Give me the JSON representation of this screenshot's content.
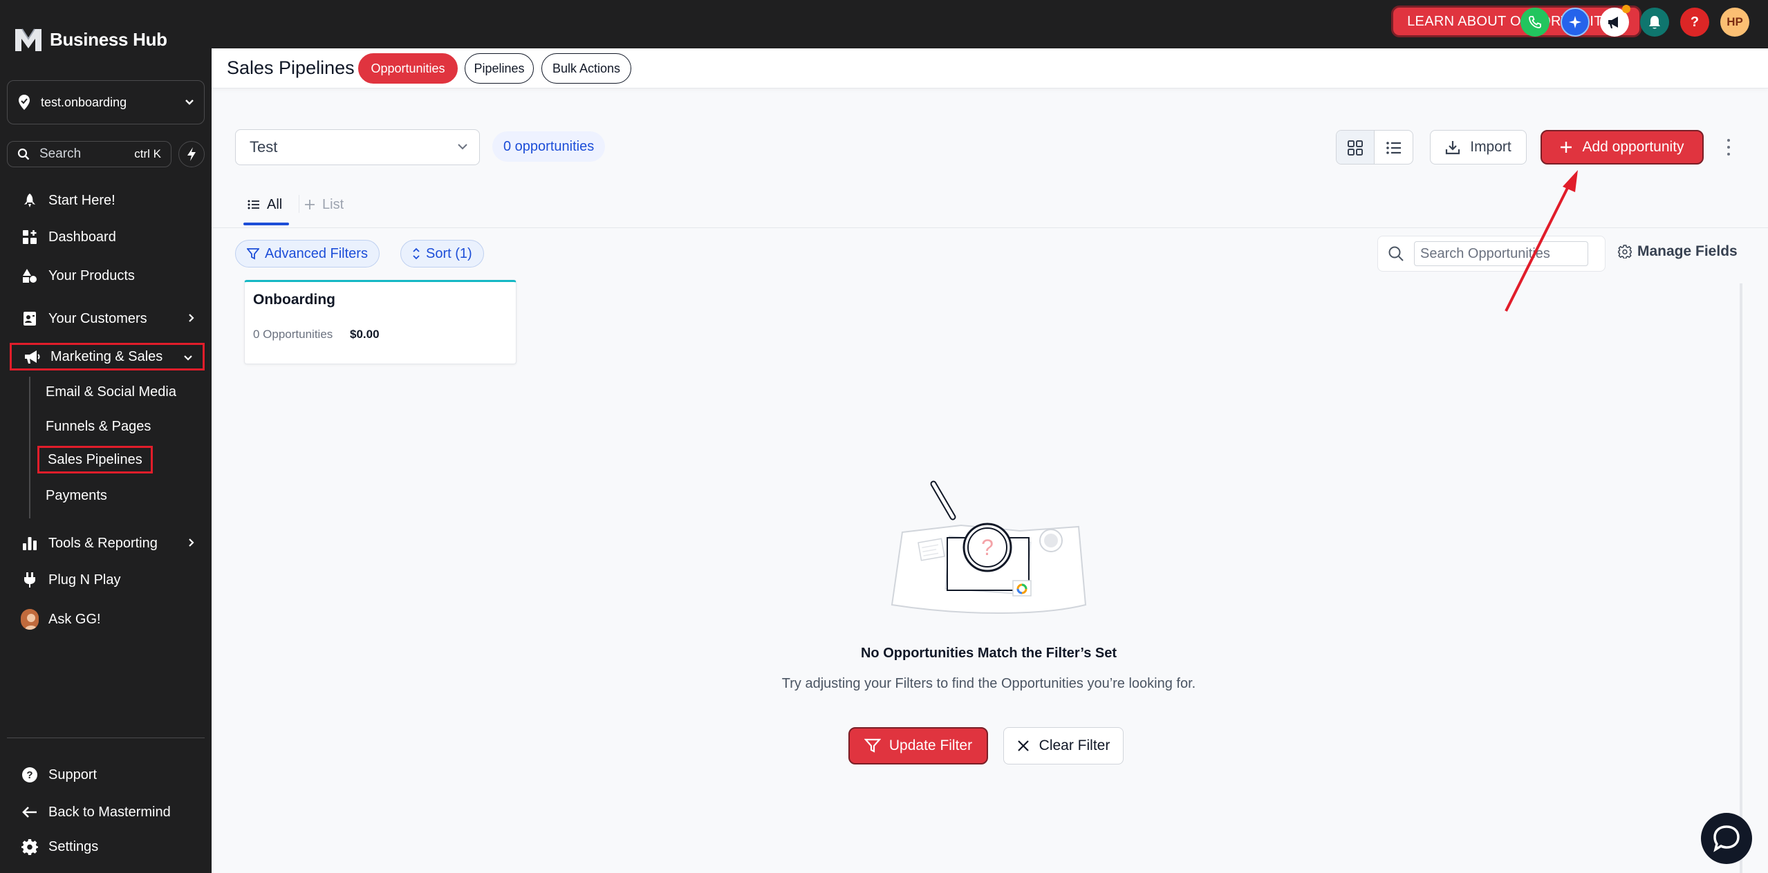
{
  "app": {
    "brand_name": "Business Hub"
  },
  "sidebar": {
    "location_name": "test.onboarding",
    "search_placeholder": "Search",
    "search_shortcut": "ctrl K",
    "items": [
      {
        "label": "Start Here!",
        "icon": "rocket-icon"
      },
      {
        "label": "Dashboard",
        "icon": "dashboard-icon"
      },
      {
        "label": "Your Products",
        "icon": "shapes-icon"
      },
      {
        "label": "Your Customers",
        "icon": "contact-card-icon"
      },
      {
        "label": "Marketing & Sales",
        "icon": "megaphone-icon"
      },
      {
        "label": "Tools & Reporting",
        "icon": "bar-chart-icon"
      },
      {
        "label": "Plug N Play",
        "icon": "plug-icon"
      },
      {
        "label": "Ask GG!",
        "icon": "avatar"
      }
    ],
    "sub_items": [
      {
        "label": "Email & Social Media"
      },
      {
        "label": "Funnels & Pages"
      },
      {
        "label": "Sales Pipelines"
      },
      {
        "label": "Payments"
      }
    ],
    "footer_items": [
      {
        "label": "Support",
        "icon": "question-circle-icon"
      },
      {
        "label": "Back to Mastermind",
        "icon": "arrow-left-icon"
      },
      {
        "label": "Settings",
        "icon": "gear-icon"
      }
    ]
  },
  "topbar": {
    "learn_label": "LEARN ABOUT OPPORTUNITIES",
    "avatar_initials": "HP",
    "help_glyph": "?",
    "colors": {
      "phone": "#22c55e",
      "ai": "#2563eb",
      "announce": "#ffffff",
      "bell": "#0f766e",
      "help": "#dc2626",
      "avatar": "#fbbf73"
    }
  },
  "header": {
    "title": "Sales Pipelines",
    "tabs": [
      {
        "label": "Opportunities",
        "active": true
      },
      {
        "label": "Pipelines",
        "active": false
      },
      {
        "label": "Bulk Actions",
        "active": false
      }
    ]
  },
  "controls": {
    "pipeline_selected": "Test",
    "count_label": "0 opportunities",
    "import_label": "Import",
    "add_label": "Add opportunity"
  },
  "view_tabs": {
    "all_label": "All",
    "list_label": "List"
  },
  "filters": {
    "advanced_label": "Advanced Filters",
    "sort_label": "Sort (1)",
    "search_placeholder": "Search Opportunities",
    "manage_fields_label": "Manage Fields"
  },
  "stages": [
    {
      "name": "Onboarding",
      "count_label": "0 Opportunities",
      "value": "$0.00"
    }
  ],
  "empty_state": {
    "title": "No Opportunities Match the Filter’s Set",
    "description": "Try adjusting your Filters to find the Opportunities you’re looking for.",
    "update_label": "Update Filter",
    "clear_label": "Clear Filter"
  },
  "theme": {
    "accent": "#e0343f",
    "link_blue": "#1d4ed8",
    "sidebar_bg": "#1f1f20",
    "stage_accent": "#14b8c4"
  }
}
